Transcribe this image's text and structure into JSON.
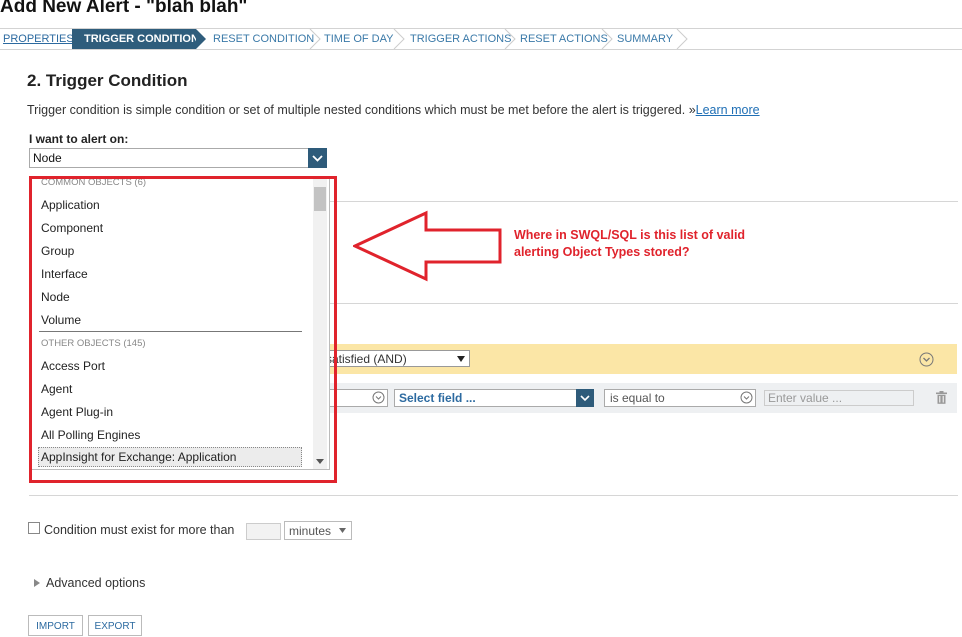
{
  "page": {
    "title": "Add New Alert - \"blah blah\""
  },
  "wizard": {
    "steps": [
      {
        "label": "PROPERTIES",
        "state": "visited"
      },
      {
        "label": "TRIGGER CONDITION",
        "state": "active"
      },
      {
        "label": "RESET CONDITION",
        "state": "pending"
      },
      {
        "label": "TIME OF DAY",
        "state": "pending"
      },
      {
        "label": "TRIGGER ACTIONS",
        "state": "pending"
      },
      {
        "label": "RESET ACTIONS",
        "state": "pending"
      },
      {
        "label": "SUMMARY",
        "state": "pending"
      }
    ]
  },
  "section": {
    "title": "2. Trigger Condition",
    "description": "Trigger condition is simple condition or set of multiple nested conditions which must be met before the alert is triggered.",
    "learn_more_prefix": "»",
    "learn_more": "Learn more"
  },
  "alert_on": {
    "label": "I want to alert on:",
    "selected": "Node",
    "groups": [
      {
        "header": "COMMON OBJECTS (6)",
        "items": [
          "Application",
          "Component",
          "Group",
          "Interface",
          "Node",
          "Volume"
        ]
      },
      {
        "header": "OTHER OBJECTS (145)",
        "items": [
          "Access Port",
          "Agent",
          "Agent Plug-in",
          "All Polling Engines",
          "AppInsight for Exchange: Application"
        ]
      }
    ]
  },
  "condition": {
    "group_operator": "e satisfied (AND)",
    "field_placeholder": "Select field ...",
    "operator": "is equal to",
    "value_placeholder": "Enter value ..."
  },
  "annotation": {
    "line1": "Where in SWQL/SQL is this list of valid",
    "line2": "alerting Object Types stored?"
  },
  "options": {
    "duration_label": "Condition must exist for more than",
    "duration_unit": "minutes",
    "advanced_label": "Advanced options"
  },
  "buttons": {
    "import": "IMPORT",
    "export": "EXPORT"
  },
  "colors": {
    "accent": "#2f5d7c",
    "annotation_red": "#e0232c",
    "group_highlight": "#fbe6a6"
  }
}
